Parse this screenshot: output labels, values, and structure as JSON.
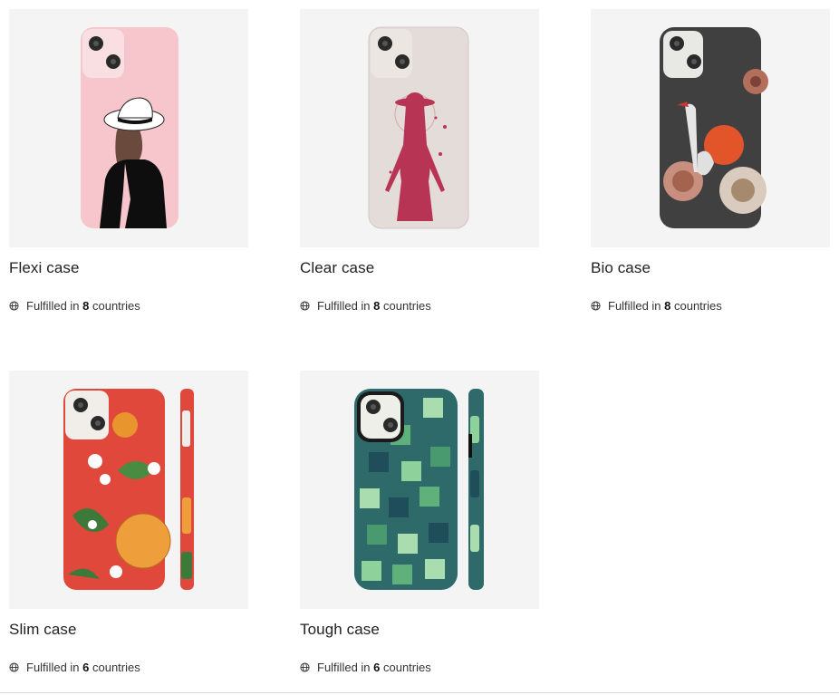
{
  "products": [
    {
      "title": "Flexi case",
      "fulfilled_prefix": "Fulfilled in ",
      "count": "8",
      "fulfilled_suffix": " countries"
    },
    {
      "title": "Clear case",
      "fulfilled_prefix": "Fulfilled in ",
      "count": "8",
      "fulfilled_suffix": " countries"
    },
    {
      "title": "Bio case",
      "fulfilled_prefix": "Fulfilled in ",
      "count": "8",
      "fulfilled_suffix": " countries"
    },
    {
      "title": "Slim case",
      "fulfilled_prefix": "Fulfilled in ",
      "count": "6",
      "fulfilled_suffix": " countries"
    },
    {
      "title": "Tough case",
      "fulfilled_prefix": "Fulfilled in ",
      "count": "6",
      "fulfilled_suffix": " countries"
    }
  ],
  "icons": {
    "globe": "globe-icon"
  },
  "colors": {
    "thumb_bg": "#f4f4f4",
    "flexi_case": "#f6c6cc",
    "clear_case": "#e4dcd8",
    "bio_case": "#404040",
    "slim_case": "#e0483c",
    "tough_case": "#2e6a6a"
  }
}
